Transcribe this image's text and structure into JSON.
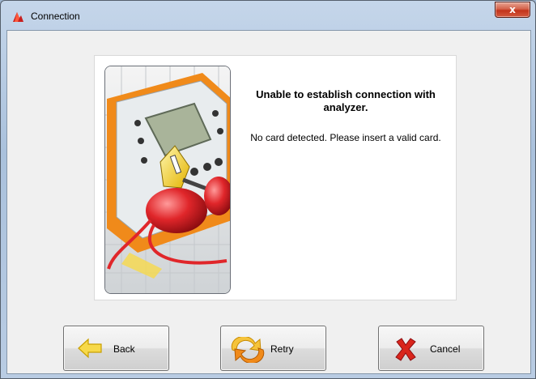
{
  "window": {
    "title": "Connection",
    "close_glyph": "x"
  },
  "message": {
    "title": "Unable to establish connection with analyzer.",
    "detail": "No card detected. Please insert a valid card."
  },
  "buttons": {
    "back": {
      "label": "Back",
      "icon": "left-arrow-icon"
    },
    "retry": {
      "label": "Retry",
      "icon": "refresh-icon"
    },
    "cancel": {
      "label": "Cancel",
      "icon": "red-x-icon"
    }
  },
  "colors": {
    "accent_orange": "#f08a1a",
    "cancel_red": "#d9261c",
    "arrow_yellow": "#f7d94a"
  }
}
